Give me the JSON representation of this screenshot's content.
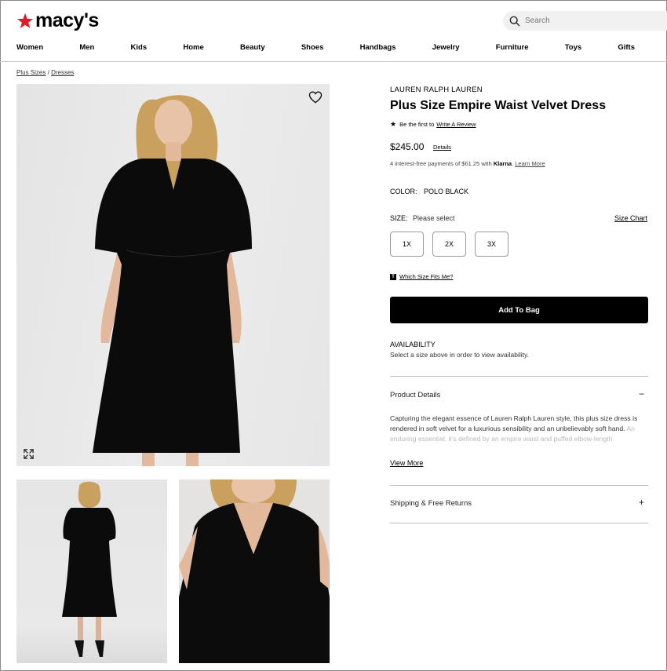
{
  "header": {
    "logo_text": "macy's",
    "brand_color": "#e21a2c",
    "search_placeholder": "Search"
  },
  "nav": [
    "Women",
    "Men",
    "Kids",
    "Home",
    "Beauty",
    "Shoes",
    "Handbags",
    "Jewelry",
    "Furniture",
    "Toys",
    "Gifts"
  ],
  "breadcrumb": [
    "Plus Sizes",
    "Dresses"
  ],
  "breadcrumb_separator": "/",
  "product": {
    "brand": "LAUREN RALPH LAUREN",
    "title": "Plus Size Empire Waist Velvet Dress",
    "review_prefix": "Be the first to",
    "review_link": "Write A Review",
    "price": "$245.00",
    "price_details": "Details",
    "klarna_text": "4 interest-free payments of $61.25 with",
    "klarna_brand": "Klarna",
    "klarna_link": "Learn More",
    "color_label": "COLOR:",
    "color_value": "POLO BLACK",
    "size_label": "SIZE:",
    "size_prompt": "Please select",
    "size_chart": "Size Chart",
    "sizes": [
      "1X",
      "2X",
      "3X"
    ],
    "fit_badge": "T",
    "fit_link": "Which Size Fits Me?",
    "add_to_bag": "Add To Bag",
    "availability_title": "AVAILABILITY",
    "availability_text": "Select a size above in order to view availability."
  },
  "accordions": {
    "details_title": "Product Details",
    "details_sign": "−",
    "description": "Capturing the elegant essence of Lauren Ralph Lauren style, this plus size dress is rendered in soft velvet for a luxurious sensibility and an unbelievably soft hand.",
    "description_fade": "An enduring essential, it's defined by an empire waist and puffed elbow-length",
    "view_more": "View More",
    "shipping_title": "Shipping & Free Returns",
    "shipping_sign": "+"
  },
  "icons": {
    "search": "search-icon",
    "heart": "heart-icon",
    "expand": "expand-icon",
    "star": "star-icon"
  }
}
